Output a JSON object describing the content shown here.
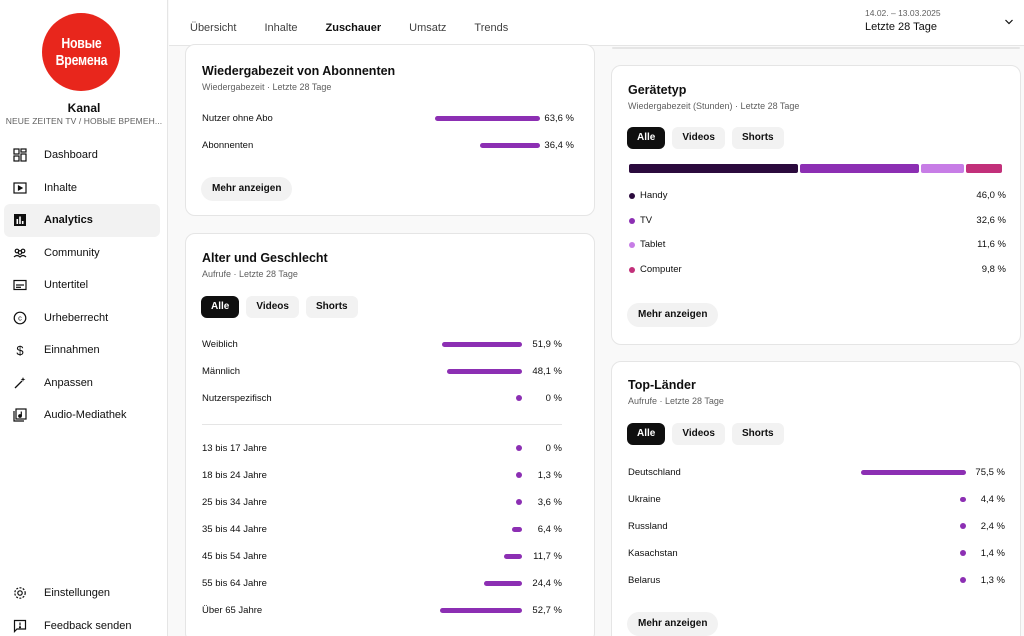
{
  "sidebar": {
    "logo_line1": "Новые",
    "logo_line2": "Времена",
    "channel_label": "Kanal",
    "channel_name": "NEUE ZEITEN TV / НОВЫЕ ВРЕМЕН...",
    "items": [
      {
        "label": "Dashboard",
        "icon": "dashboard-icon"
      },
      {
        "label": "Inhalte",
        "icon": "content-icon"
      },
      {
        "label": "Analytics",
        "icon": "analytics-icon"
      },
      {
        "label": "Community",
        "icon": "community-icon"
      },
      {
        "label": "Untertitel",
        "icon": "subtitles-icon"
      },
      {
        "label": "Urheberrecht",
        "icon": "copyright-icon"
      },
      {
        "label": "Einnahmen",
        "icon": "dollar-icon"
      },
      {
        "label": "Anpassen",
        "icon": "magic-wand-icon"
      },
      {
        "label": "Audio-Mediathek",
        "icon": "audio-library-icon"
      }
    ],
    "bottom_items": [
      {
        "label": "Einstellungen",
        "icon": "gear-icon"
      },
      {
        "label": "Feedback senden",
        "icon": "feedback-icon"
      }
    ]
  },
  "topbar": {
    "tabs": [
      "Übersicht",
      "Inhalte",
      "Zuschauer",
      "Umsatz",
      "Trends"
    ],
    "active_tab": "Zuschauer",
    "date_range": "14.02. – 13.03.2025",
    "period": "Letzte 28 Tage"
  },
  "subscribers_card": {
    "title": "Wiedergabezeit von Abonnenten",
    "subtitle": "Wiedergabezeit · Letzte 28 Tage",
    "rows": [
      {
        "label": "Nutzer ohne Abo",
        "value": "63,6 %",
        "pct": 63.6
      },
      {
        "label": "Abonnenten",
        "value": "36,4 %",
        "pct": 36.4
      }
    ],
    "more": "Mehr anzeigen"
  },
  "age_card": {
    "title": "Alter und Geschlecht",
    "subtitle": "Aufrufe · Letzte 28 Tage",
    "chips": [
      "Alle",
      "Videos",
      "Shorts"
    ],
    "gender_rows": [
      {
        "label": "Weiblich",
        "value": "51,9 %",
        "pct": 51.9
      },
      {
        "label": "Männlich",
        "value": "48,1 %",
        "pct": 48.1
      },
      {
        "label": "Nutzerspezifisch",
        "value": "0 %",
        "pct": 0
      }
    ],
    "age_rows": [
      {
        "label": "13 bis 17 Jahre",
        "value": "0 %",
        "pct": 0
      },
      {
        "label": "18 bis 24 Jahre",
        "value": "1,3 %",
        "pct": 1.3
      },
      {
        "label": "25 bis 34 Jahre",
        "value": "3,6 %",
        "pct": 3.6
      },
      {
        "label": "35 bis 44 Jahre",
        "value": "6,4 %",
        "pct": 6.4
      },
      {
        "label": "45 bis 54 Jahre",
        "value": "11,7 %",
        "pct": 11.7
      },
      {
        "label": "55 bis 64 Jahre",
        "value": "24,4 %",
        "pct": 24.4
      },
      {
        "label": "Über 65 Jahre",
        "value": "52,7 %",
        "pct": 52.7
      }
    ]
  },
  "device_card": {
    "title": "Gerätetyp",
    "subtitle": "Wiedergabezeit (Stunden) · Letzte 28 Tage",
    "chips": [
      "Alle",
      "Videos",
      "Shorts"
    ],
    "rows": [
      {
        "label": "Handy",
        "value": "46,0 %",
        "pct": 46.0,
        "color": "#2b0a3d"
      },
      {
        "label": "TV",
        "value": "32,6 %",
        "pct": 32.6,
        "color": "#8c2fb3"
      },
      {
        "label": "Tablet",
        "value": "11,6 %",
        "pct": 11.6,
        "color": "#c77de6"
      },
      {
        "label": "Computer",
        "value": "9,8 %",
        "pct": 9.8,
        "color": "#c2307a"
      }
    ],
    "more": "Mehr anzeigen"
  },
  "countries_card": {
    "title": "Top-Länder",
    "subtitle": "Aufrufe · Letzte 28 Tage",
    "chips": [
      "Alle",
      "Videos",
      "Shorts"
    ],
    "rows": [
      {
        "label": "Deutschland",
        "value": "75,5 %",
        "pct": 75.5
      },
      {
        "label": "Ukraine",
        "value": "4,4 %",
        "pct": 4.4
      },
      {
        "label": "Russland",
        "value": "2,4 %",
        "pct": 2.4
      },
      {
        "label": "Kasachstan",
        "value": "1,4 %",
        "pct": 1.4
      },
      {
        "label": "Belarus",
        "value": "1,3 %",
        "pct": 1.3
      }
    ],
    "more": "Mehr anzeigen"
  },
  "colors": {
    "accent_bar": "#8c2fb3",
    "logo_red": "#e8261c"
  }
}
